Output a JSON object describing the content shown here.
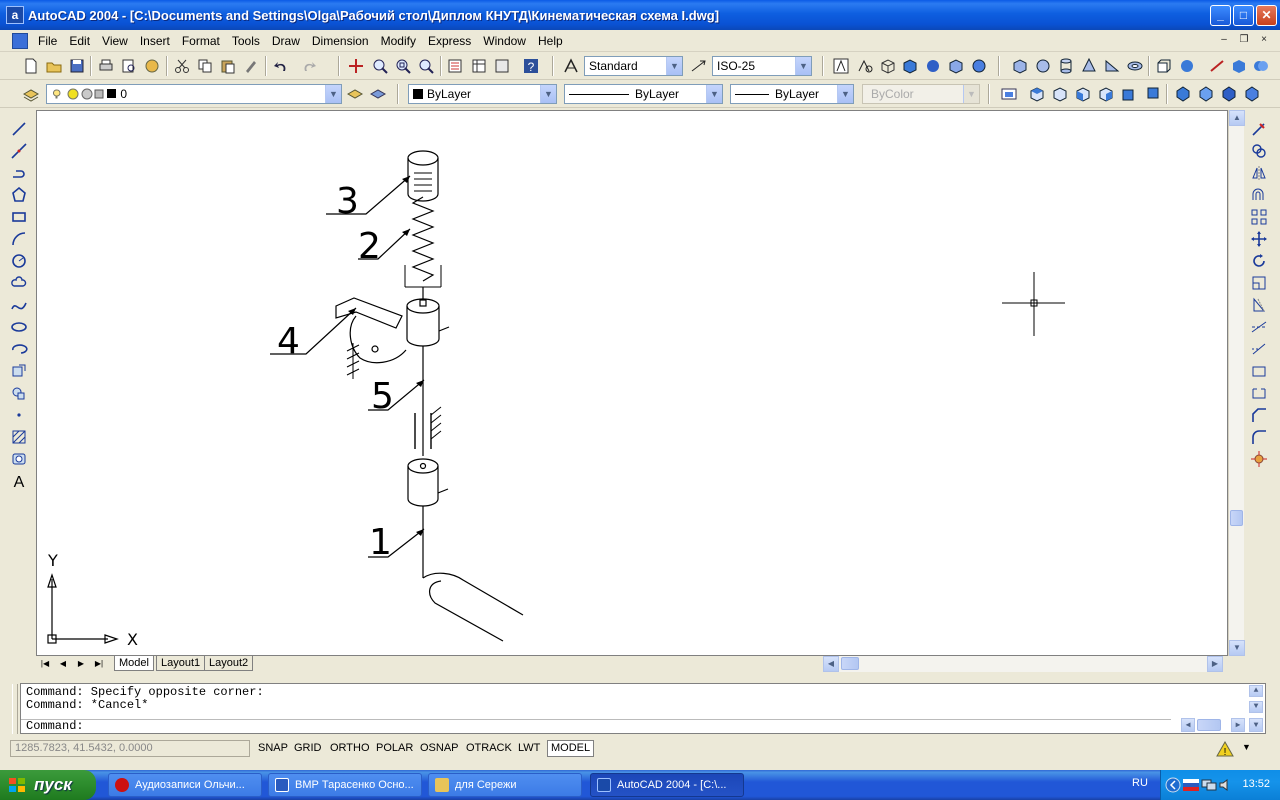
{
  "window": {
    "title": "AutoCAD 2004 - [C:\\Documents and Settings\\Olga\\Рабочий стол\\Диплом КНУТД\\Кинематическая схема I.dwg]",
    "app_icon_letter": "a",
    "btn_minimize": "_",
    "btn_maximize": "□",
    "btn_close": "✕"
  },
  "menu": {
    "items": [
      "File",
      "Edit",
      "View",
      "Insert",
      "Format",
      "Tools",
      "Draw",
      "Dimension",
      "Modify",
      "Express",
      "Window",
      "Help"
    ],
    "mdi_minimize": "–",
    "mdi_restore": "❐",
    "mdi_close": "×"
  },
  "toolbar": {
    "text_style": "Standard",
    "dim_style": "ISO-25",
    "layer": "0",
    "color": "ByLayer",
    "linetype": "ByLayer",
    "lineweight": "ByLayer",
    "plotstyle": "ByColor",
    "dropdown_arrow": "▼"
  },
  "drawing": {
    "labels": [
      "3",
      "2",
      "4",
      "5",
      "1"
    ],
    "ucs_y": "Y",
    "ucs_x": "X"
  },
  "layout_tabs": {
    "tabs": [
      "Model",
      "Layout1",
      "Layout2"
    ],
    "active": "Model",
    "nav_first": "|◀",
    "nav_prev": "◀",
    "nav_next": "▶",
    "nav_last": "▶|"
  },
  "command": {
    "history": [
      "Command: Specify opposite corner:",
      "Command: *Cancel*"
    ],
    "prompt": "Command:"
  },
  "status": {
    "coordinates": "1285.7823, 41.5432, 0.0000",
    "toggles": [
      "SNAP",
      "GRID",
      "ORTHO",
      "POLAR",
      "OSNAP",
      "OTRACK",
      "LWT",
      "MODEL"
    ],
    "active_toggle": "MODEL"
  },
  "taskbar": {
    "start_label": "пуск",
    "tasks": [
      "Аудиозаписи Ольчи...",
      "ВМР Тарасенко Осно...",
      "для Сережи",
      "AutoCAD 2004 - [C:\\..."
    ],
    "active_task": "AutoCAD 2004 - [C:\\...",
    "language": "RU",
    "clock": "13:52"
  },
  "colors": {
    "titlebar": "#0A5AE6",
    "taskbar": "#2157D7",
    "start": "#2F8F2F",
    "drawing_bg": "#FFFFFF",
    "chrome": "#ECE9D8"
  }
}
